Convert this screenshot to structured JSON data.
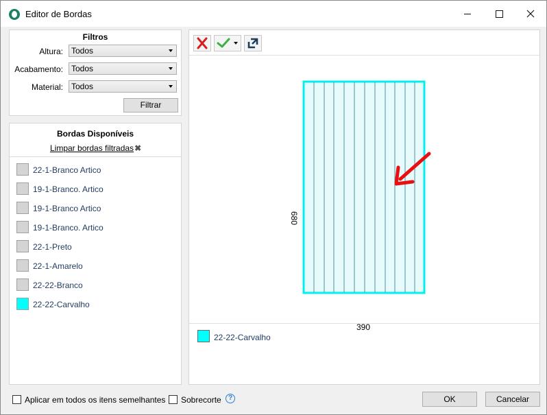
{
  "window": {
    "title": "Editor de Bordas"
  },
  "filters": {
    "title": "Filtros",
    "rows": [
      {
        "label": "Altura:",
        "value": "Todos"
      },
      {
        "label": "Acabamento:",
        "value": "Todos"
      },
      {
        "label": "Material:",
        "value": "Todos"
      }
    ],
    "button_label": "Filtrar"
  },
  "bordas": {
    "title": "Bordas Disponíveis",
    "clear_link": "Limpar bordas filtradas",
    "items": [
      {
        "label": "22-1-Branco Artico",
        "color": "#d4d4d4"
      },
      {
        "label": "19-1-Branco. Artico",
        "color": "#d4d4d4"
      },
      {
        "label": "19-1-Branco Artico",
        "color": "#d4d4d4"
      },
      {
        "label": "19-1-Branco. Artico",
        "color": "#d4d4d4"
      },
      {
        "label": "22-1-Preto",
        "color": "#d4d4d4"
      },
      {
        "label": "22-1-Amarelo",
        "color": "#d4d4d4"
      },
      {
        "label": "22-22-Branco",
        "color": "#d4d4d4"
      },
      {
        "label": "22-22-Carvalho",
        "color": "#00ffff"
      }
    ]
  },
  "toolbar": {
    "remove_icon": "red-x-icon",
    "apply_icon": "green-check-icon",
    "expand_icon": "expand-icon"
  },
  "preview": {
    "width_label": "390",
    "height_label": "680",
    "border_color": "#00f0f0",
    "fill_color": "#e8fbfc",
    "arrow_color": "#e81010"
  },
  "legend": {
    "label": "22-22-Carvalho",
    "color": "#00ffff"
  },
  "footer": {
    "apply_all_label": "Aplicar em todos os itens semelhantes",
    "overcut_label": "Sobrecorte",
    "ok_label": "OK",
    "cancel_label": "Cancelar"
  }
}
